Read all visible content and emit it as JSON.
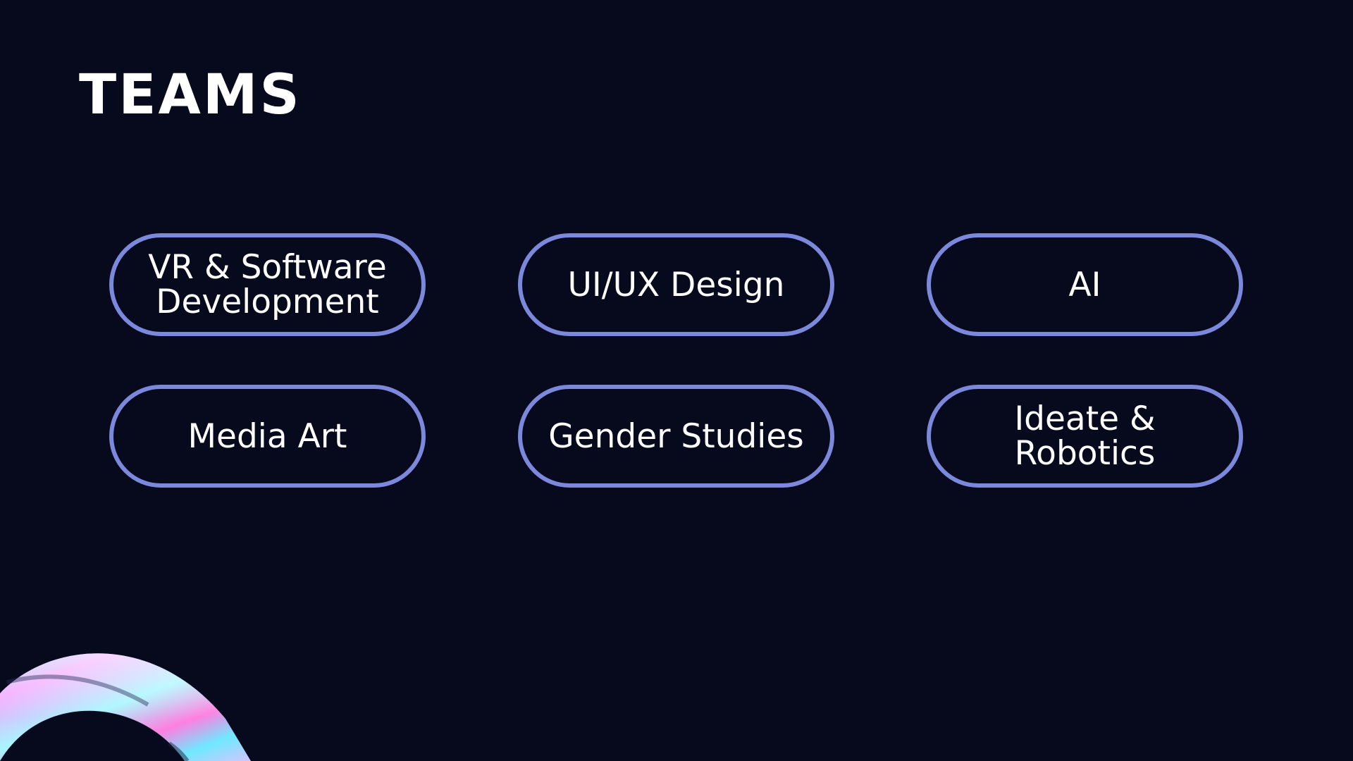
{
  "slide": {
    "title": "TEAMS",
    "background_color": "#070a1d",
    "accent_color": "#7b88db",
    "teams": [
      {
        "label": "VR & Software Development"
      },
      {
        "label": "UI/UX Design"
      },
      {
        "label": "AI"
      },
      {
        "label": "Media Art"
      },
      {
        "label": "Gender Studies"
      },
      {
        "label": "Ideate & Robotics"
      }
    ],
    "decoration": "iridescent-ring"
  }
}
